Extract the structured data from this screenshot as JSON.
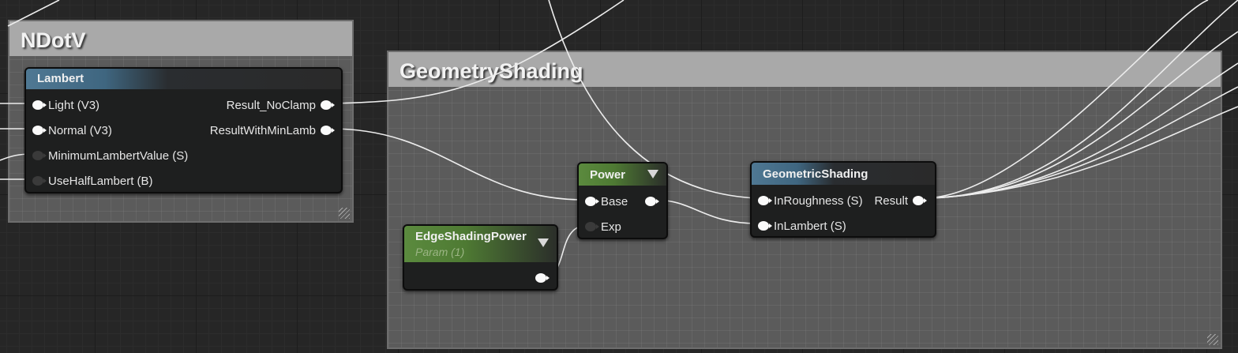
{
  "comments": [
    {
      "title": "NDotV"
    },
    {
      "title": "GeometryShading"
    }
  ],
  "nodes": {
    "lambert": {
      "title": "Lambert",
      "inputs": [
        "Light (V3)",
        "Normal (V3)",
        "MinimumLambertValue (S)",
        "UseHalfLambert (B)"
      ],
      "outputs": [
        "Result_NoClamp",
        "ResultWithMinLamb"
      ]
    },
    "power": {
      "title": "Power",
      "inputs": [
        "Base",
        "Exp"
      ]
    },
    "edge": {
      "title": "EdgeShadingPower",
      "subtitle": "Param (1)"
    },
    "geo": {
      "title": "GeometricShading",
      "inputs": [
        "InRoughness (S)",
        "InLambert (S)"
      ],
      "output": "Result"
    }
  },
  "colors": {
    "function_header": "#4f7893",
    "param_header": "#5b8a3e",
    "comment_header": "#a9a9a9",
    "wire": "#f0f0f0"
  }
}
